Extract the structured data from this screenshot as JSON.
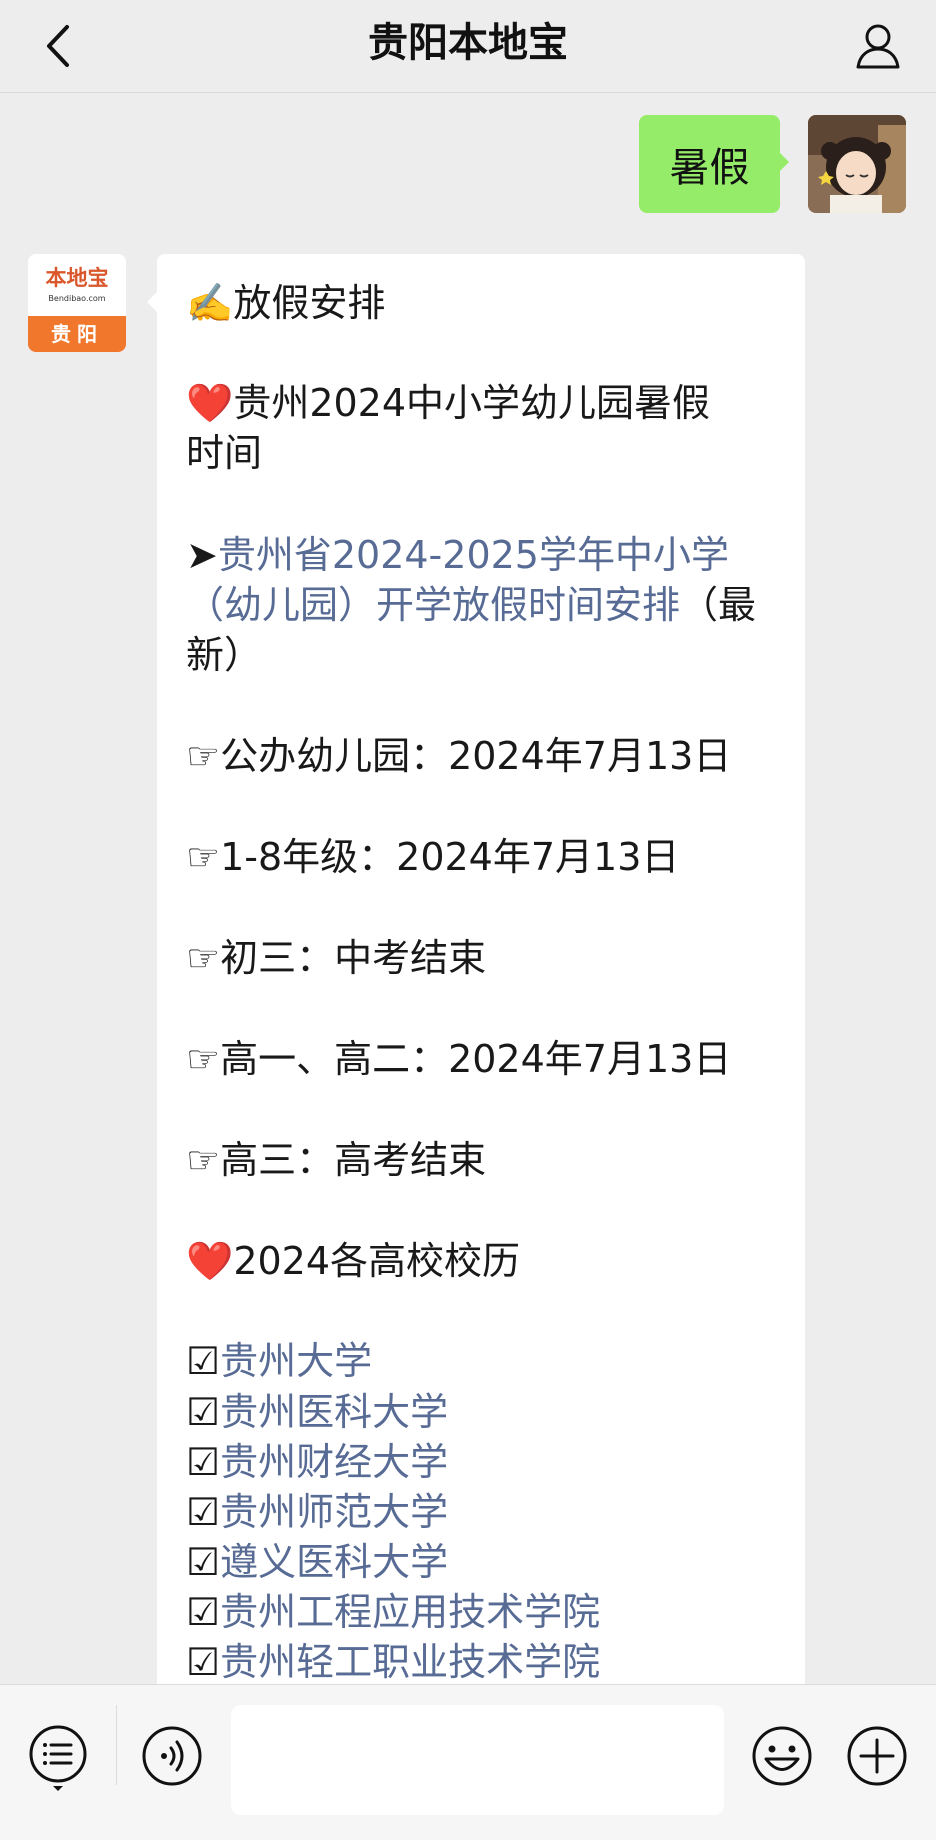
{
  "header": {
    "title": "贵阳本地宝",
    "back_icon": "chevron-left-icon",
    "profile_icon": "person-icon"
  },
  "outgoing": {
    "text": "暑假"
  },
  "bot": {
    "logo_main": "本地宝",
    "logo_sub": "Bendibao.com",
    "logo_city": "贵阳"
  },
  "message": {
    "section1": "放假安排",
    "section1_emoji": "✍️",
    "heading2_line1": "贵州2024中小学幼儿园暑假",
    "heading2_line2": "时间",
    "heart": "❤️",
    "arrow": "➤",
    "link_line1": "贵州省2024-2025学年中小学",
    "link_line2": "（幼儿园）开学放假时间安排",
    "link_after": "（最",
    "link_line3": "新）",
    "hand": "☞",
    "items": [
      "公办幼儿园：2024年7月13日",
      "1-8年级：2024年7月13日",
      "初三：中考结束",
      "高一、高二：2024年7月13日",
      "高三：高考结束"
    ],
    "heading3": "2024各高校校历",
    "check": "☑",
    "universities": [
      "贵州大学",
      "贵州医科大学",
      "贵州财经大学",
      "贵州师范大学",
      "遵义医科大学",
      "贵州工程应用技术学院",
      "贵州轻工职业技术学院"
    ]
  },
  "toolbar": {
    "menu_icon": "menu-icon",
    "voice_icon": "voice-icon",
    "emoji_icon": "emoji-icon",
    "plus_icon": "plus-icon",
    "input_value": ""
  },
  "colors": {
    "outgoing_bubble": "#95ec69",
    "link": "#576b95",
    "background": "#ededed",
    "logo_orange": "#f0772c"
  }
}
